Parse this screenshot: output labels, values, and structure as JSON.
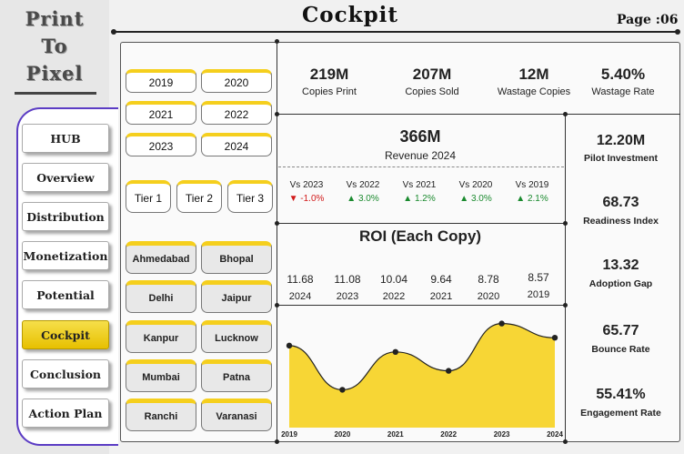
{
  "logo": {
    "line1": "Print",
    "line2": "To",
    "line3": "Pixel"
  },
  "nav": [
    {
      "label": "HUB"
    },
    {
      "label": "Overview"
    },
    {
      "label": "Distribution"
    },
    {
      "label": "Monetization"
    },
    {
      "label": "Potential"
    },
    {
      "label": "Cockpit"
    },
    {
      "label": "Conclusion"
    },
    {
      "label": "Action Plan"
    }
  ],
  "header": {
    "title": "Cockpit",
    "page": "Page :06"
  },
  "years": [
    "2019",
    "2020",
    "2021",
    "2022",
    "2023",
    "2024"
  ],
  "tiers": [
    "Tier 1",
    "Tier 2",
    "Tier 3"
  ],
  "cities": [
    "Ahmedabad",
    "Bhopal",
    "Delhi",
    "Jaipur",
    "Kanpur",
    "Lucknow",
    "Mumbai",
    "Patna",
    "Ranchi",
    "Varanasi"
  ],
  "kpis": [
    {
      "value": "219M",
      "label": "Copies Print"
    },
    {
      "value": "207M",
      "label": "Copies Sold"
    },
    {
      "value": "12M",
      "label": "Wastage Copies"
    },
    {
      "value": "5.40%",
      "label": "Wastage Rate"
    }
  ],
  "revenue": {
    "value": "366M",
    "label": "Revenue 2024"
  },
  "comparisons": [
    {
      "label": "Vs 2023",
      "value": "-1.0%",
      "direction": "down"
    },
    {
      "label": "Vs 2022",
      "value": "3.0%",
      "direction": "up"
    },
    {
      "label": "Vs 2021",
      "value": "1.2%",
      "direction": "up"
    },
    {
      "label": "Vs 2020",
      "value": "3.0%",
      "direction": "up"
    },
    {
      "label": "Vs 2019",
      "value": "2.1%",
      "direction": "up"
    }
  ],
  "roi": {
    "title": "ROI (Each Copy)",
    "items": [
      {
        "value": "11.68",
        "year": "2024"
      },
      {
        "value": "11.08",
        "year": "2023"
      },
      {
        "value": "10.04",
        "year": "2022"
      },
      {
        "value": "9.64",
        "year": "2021"
      },
      {
        "value": "8.78",
        "year": "2020"
      },
      {
        "value": "8.57",
        "year": "2019"
      }
    ]
  },
  "side_metrics": [
    {
      "value": "12.20M",
      "label": "Pilot Investment"
    },
    {
      "value": "68.73",
      "label": "Readiness Index"
    },
    {
      "value": "13.32",
      "label": "Adoption Gap"
    },
    {
      "value": "65.77",
      "label": "Bounce Rate"
    },
    {
      "value": "55.41%",
      "label": "Engagement Rate"
    }
  ],
  "colors": {
    "accent": "#f5cf1d",
    "area_fill": "#f7d635",
    "up": "#1a8a2e",
    "down": "#d11a1a",
    "nav_border": "#5b3cc4"
  },
  "chart_data": {
    "type": "area",
    "x": [
      "2019",
      "2020",
      "2021",
      "2022",
      "2023",
      "2024"
    ],
    "values": [
      5.2,
      2.4,
      4.8,
      3.6,
      6.6,
      5.7
    ],
    "ylim": [
      0,
      7.5
    ],
    "title": "",
    "xlabel": "",
    "ylabel": "",
    "grid": false
  }
}
